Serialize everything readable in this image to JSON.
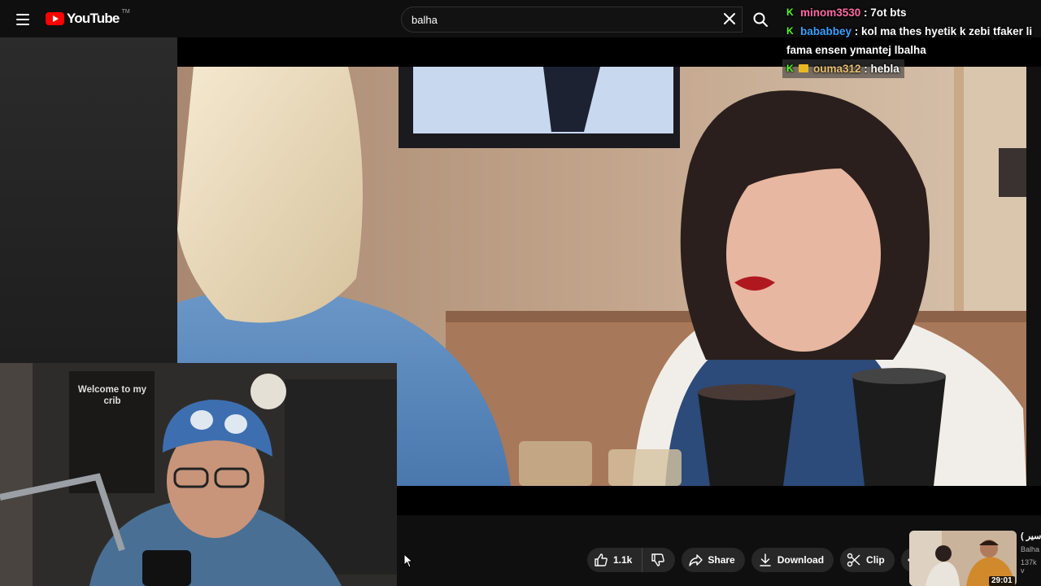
{
  "header": {
    "logo_text": "YouTube",
    "logo_tm": "TM",
    "search": {
      "value": "balha"
    }
  },
  "chat": {
    "messages": [
      {
        "user": "minom3530",
        "separator": " : ",
        "text": "7ot bts",
        "user_color": "#ff6aa6"
      },
      {
        "user": "bababbey",
        "separator": " : ",
        "text": "kol ma thes hyetik k zebi tfaker li fama ensen ymantej lbalha",
        "user_color": "#3aa0ff"
      },
      {
        "user": "ouma312",
        "separator": " : ",
        "text": "hebla",
        "user_color": "#e8c070"
      }
    ],
    "badge_glyph": "K"
  },
  "webcam": {
    "poster_text": "Welcome to my crib"
  },
  "actions": {
    "like_count": "1.1k",
    "share_label": "Share",
    "download_label": "Download",
    "clip_label": "Clip"
  },
  "suggestion": {
    "title": "( سير",
    "channel": "Balha",
    "views": "137k v",
    "duration": "29:01"
  }
}
